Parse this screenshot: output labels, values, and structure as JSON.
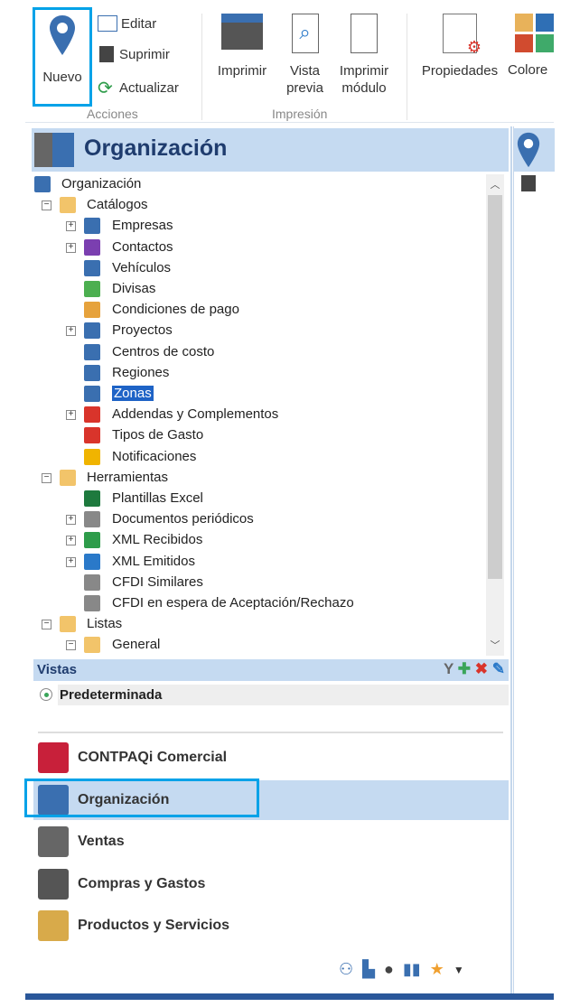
{
  "ribbon": {
    "nuevo": "Nuevo",
    "editar": "Editar",
    "suprimir": "Suprimir",
    "actualizar": "Actualizar",
    "group_acciones": "Acciones",
    "imprimir": "Imprimir",
    "vista_previa_1": "Vista",
    "vista_previa_2": "previa",
    "imprimir_modulo_1": "Imprimir",
    "imprimir_modulo_2": "módulo",
    "group_impresion": "Impresión",
    "propiedades": "Propiedades",
    "colores": "Colore"
  },
  "panel": {
    "title": "Organización"
  },
  "tree": [
    {
      "label": "Organización",
      "level": 0
    },
    {
      "label": "Catálogos",
      "level": 1,
      "exp": "−"
    },
    {
      "label": "Empresas",
      "level": 2,
      "exp": "+",
      "color": "#3a6fb0"
    },
    {
      "label": "Contactos",
      "level": 2,
      "exp": "+",
      "color": "#7b3fb0"
    },
    {
      "label": "Vehículos",
      "level": 2,
      "color": "#3a6fb0"
    },
    {
      "label": "Divisas",
      "level": 2,
      "color": "#4caf50"
    },
    {
      "label": "Condiciones de pago",
      "level": 2,
      "color": "#e6a23c"
    },
    {
      "label": "Proyectos",
      "level": 2,
      "exp": "+",
      "color": "#3a6fb0"
    },
    {
      "label": "Centros de costo",
      "level": 2,
      "color": "#3a6fb0"
    },
    {
      "label": "Regiones",
      "level": 2,
      "color": "#3a6fb0"
    },
    {
      "label": "Zonas",
      "level": 2,
      "color": "#3a6fb0",
      "selected": true
    },
    {
      "label": "Addendas y Complementos",
      "level": 2,
      "exp": "+",
      "color": "#d9342b"
    },
    {
      "label": "Tipos de Gasto",
      "level": 2,
      "color": "#d9342b"
    },
    {
      "label": "Notificaciones",
      "level": 2,
      "color": "#f0b400"
    },
    {
      "label": "Herramientas",
      "level": 1,
      "exp": "−"
    },
    {
      "label": "Plantillas Excel",
      "level": 2,
      "color": "#1e7a3e"
    },
    {
      "label": "Documentos periódicos",
      "level": 2,
      "exp": "+",
      "color": "#888"
    },
    {
      "label": "XML Recibidos",
      "level": 2,
      "exp": "+",
      "color": "#2e9c4a"
    },
    {
      "label": "XML Emitidos",
      "level": 2,
      "exp": "+",
      "color": "#2a79c9"
    },
    {
      "label": "CFDI Similares",
      "level": 2,
      "color": "#888"
    },
    {
      "label": "CFDI en espera de Aceptación/Rechazo",
      "level": 2,
      "color": "#888"
    },
    {
      "label": "Listas",
      "level": 1,
      "exp": "−"
    },
    {
      "label": "General",
      "level": 2,
      "exp": "−",
      "folder": true
    }
  ],
  "vistas": {
    "title": "Vistas",
    "default_view": "Predeterminada"
  },
  "nav": [
    {
      "label": "CONTPAQi Comercial",
      "color": "#c8203a"
    },
    {
      "label": "Organización",
      "color": "#3a6fb0",
      "active": true
    },
    {
      "label": "Ventas",
      "color": "#666"
    },
    {
      "label": "Compras y Gastos",
      "color": "#555"
    },
    {
      "label": "Productos y Servicios",
      "color": "#d8aa4a"
    }
  ],
  "colors": {
    "accent": "#00a2e8",
    "header": "#c5daf1",
    "title": "#1f3c6e"
  }
}
